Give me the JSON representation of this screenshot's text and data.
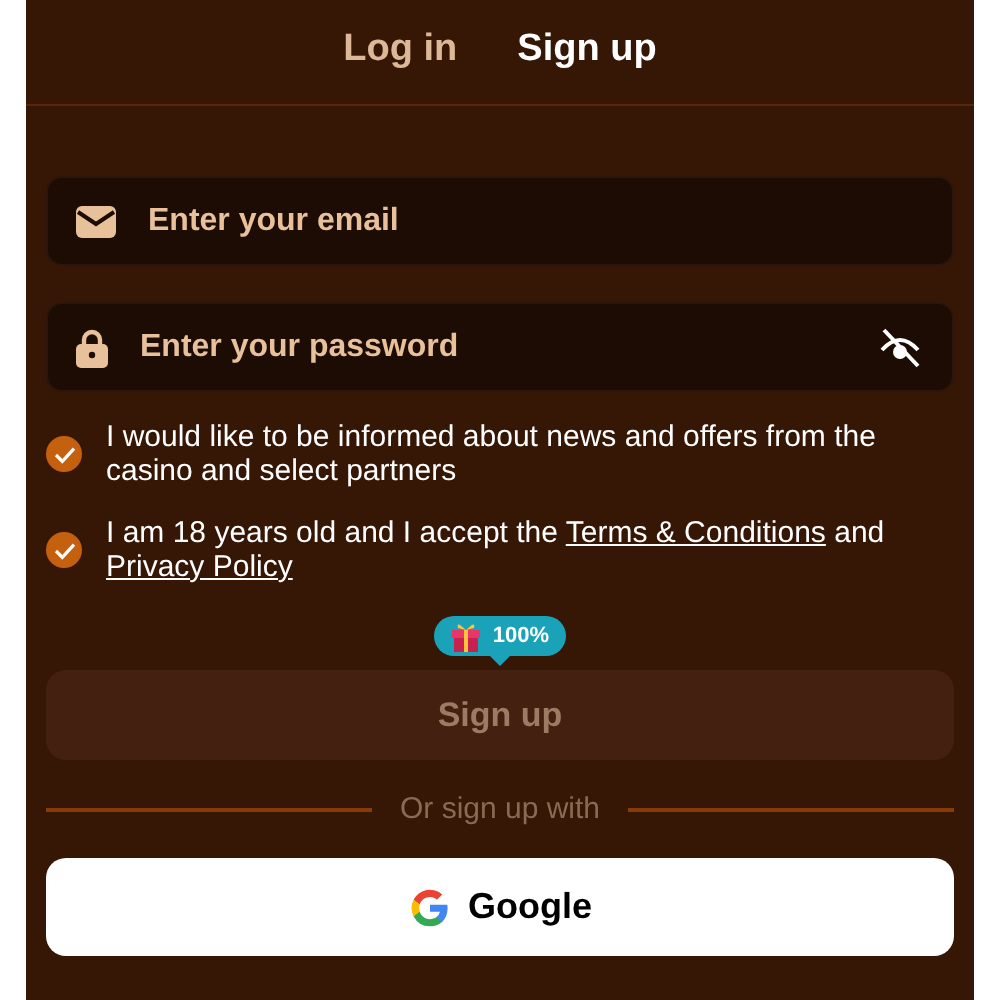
{
  "tabs": [
    {
      "label": "Log in",
      "selected": false
    },
    {
      "label": "Sign up",
      "selected": true
    }
  ],
  "fields": [
    {
      "kind": "email",
      "placeholder": "Enter your email"
    },
    {
      "kind": "password",
      "placeholder": "Enter your password"
    }
  ],
  "consents": [
    {
      "checked": true,
      "parts": [
        {
          "text": "I would like to be informed about news and offers from the casino and select partners",
          "link": false
        }
      ]
    },
    {
      "checked": true,
      "parts": [
        {
          "text": "I am 18 years old and I accept the ",
          "link": false
        },
        {
          "text": "Terms & Conditions",
          "link": true
        },
        {
          "text": " and ",
          "link": false
        },
        {
          "text": "Privacy Policy",
          "link": true
        }
      ]
    }
  ],
  "bonus_badge": {
    "text": "100%"
  },
  "submit": {
    "label": "Sign up",
    "disabled": true
  },
  "divider_text": "Or sign up with",
  "social_buttons": [
    {
      "label": "Google"
    }
  ]
}
